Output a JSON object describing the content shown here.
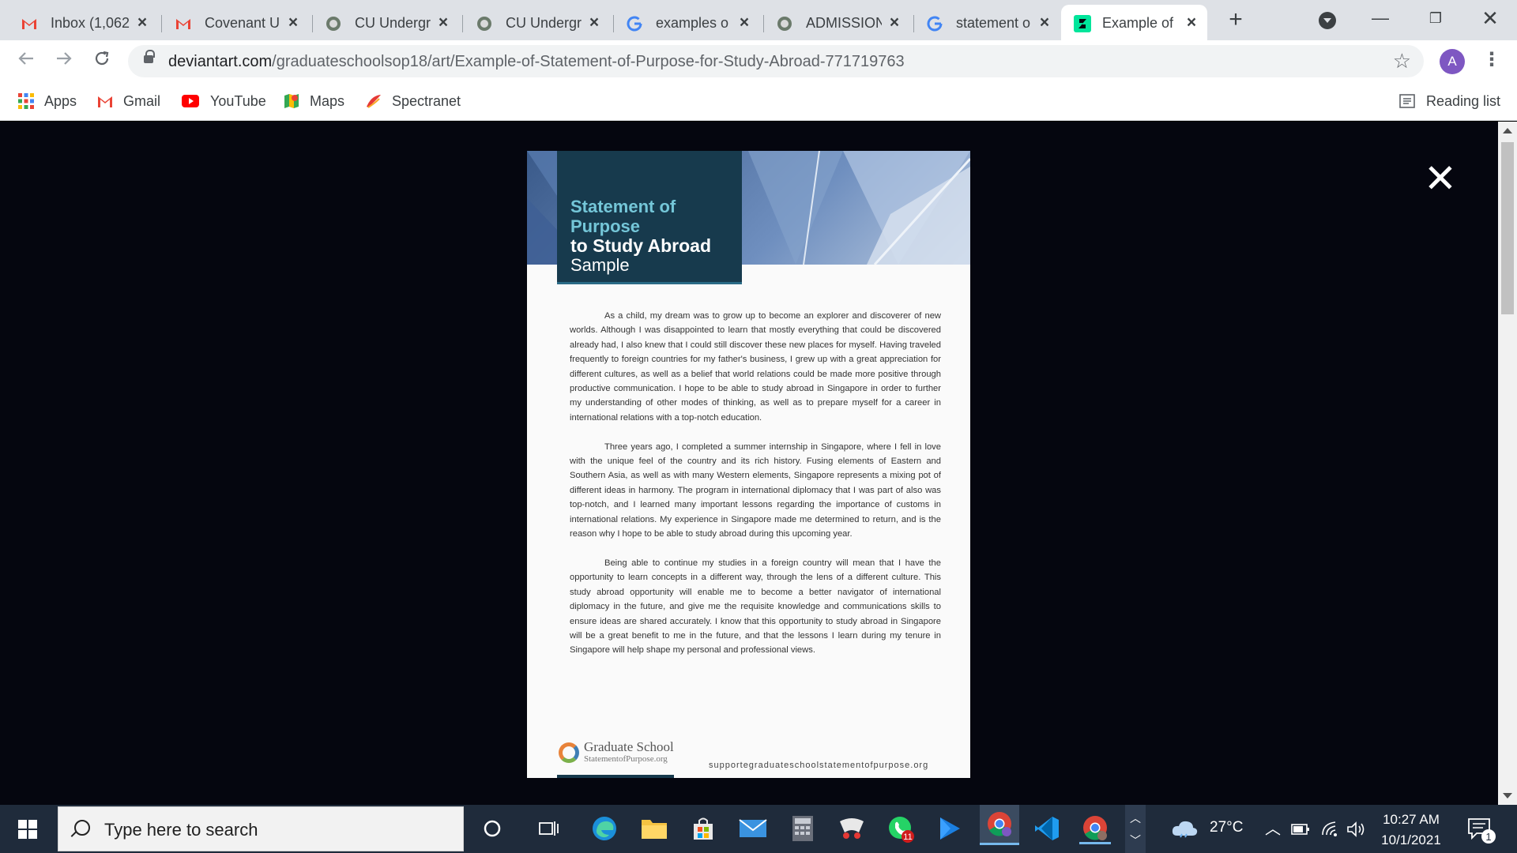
{
  "tabs": [
    {
      "label": "Inbox (1,062)",
      "favicon": "gmail-icon"
    },
    {
      "label": "Covenant U",
      "favicon": "gmail-icon"
    },
    {
      "label": "CU Undergr",
      "favicon": "university-crest-icon"
    },
    {
      "label": "CU Undergr",
      "favicon": "university-crest-icon"
    },
    {
      "label": "examples o",
      "favicon": "google-icon"
    },
    {
      "label": "ADMISSION",
      "favicon": "university-crest-icon"
    },
    {
      "label": "statement o",
      "favicon": "google-icon"
    },
    {
      "label": "Example of",
      "favicon": "deviantart-icon",
      "active": true
    }
  ],
  "toolbar": {
    "url_host": "deviantart.com",
    "url_path": "/graduateschoolsop18/art/Example-of-Statement-of-Purpose-for-Study-Abroad-771719763",
    "profile_initial": "A"
  },
  "bookmarks": {
    "items": [
      {
        "label": "Apps",
        "icon": "apps-grid-icon"
      },
      {
        "label": "Gmail",
        "icon": "gmail-icon"
      },
      {
        "label": "YouTube",
        "icon": "youtube-icon"
      },
      {
        "label": "Maps",
        "icon": "maps-icon"
      },
      {
        "label": "Spectranet",
        "icon": "spectranet-icon"
      }
    ],
    "reading_list": "Reading list"
  },
  "document": {
    "title_line1": "Statement of Purpose",
    "title_line2": "to Study Abroad",
    "title_line3": "Sample",
    "paragraphs": [
      "As a child, my dream was to grow up to become an explorer and discoverer of new worlds. Although I was disappointed to learn that mostly everything that could be discovered already had, I also knew that I could still discover these new places for myself. Having traveled frequently to foreign countries for my father's business, I grew up with a great appreciation for different cultures, as well as a belief that world relations could be made more positive through productive communication. I hope to be able to study abroad in Singapore in order to further my understanding of other modes of thinking, as well as to prepare myself for a career in international relations with a top-notch education.",
      "Three years ago, I completed a summer internship in Singapore, where I fell in love with the unique feel of the country and its rich history. Fusing elements of Eastern and Southern Asia, as well as with many Western elements, Singapore represents a mixing pot of different ideas in harmony. The program in international diplomacy that I was part of also was top-notch, and I learned many important lessons regarding the importance of customs in international relations. My experience in Singapore made me determined to return, and is the reason why I hope to be able to study abroad during this upcoming year.",
      "Being able to continue my studies in a foreign country will mean that I have the opportunity to learn concepts in a different way, through the lens of a different culture. This study abroad opportunity will enable me to become a better navigator of international diplomacy in the future, and give me the requisite knowledge and communications skills to ensure ideas are shared accurately. I know that this opportunity to study abroad in Singapore will be a great benefit to me in the future, and that the lessons I learn during my tenure in Singapore will help shape my personal and professional views."
    ],
    "logo_line1": "Graduate School",
    "logo_line2": "StatementofPurpose.org",
    "site": "supportegraduateschoolstatementofpurpose.org"
  },
  "taskbar": {
    "search_placeholder": "Type here to search",
    "whatsapp_badge": "11",
    "temperature": "27°C",
    "time": "10:27 AM",
    "date": "10/1/2021",
    "notifications": "1"
  },
  "colors": {
    "accent_title": "#74c6d8",
    "doc_header": "#173a4d",
    "taskbar": "#1f2b3b"
  }
}
